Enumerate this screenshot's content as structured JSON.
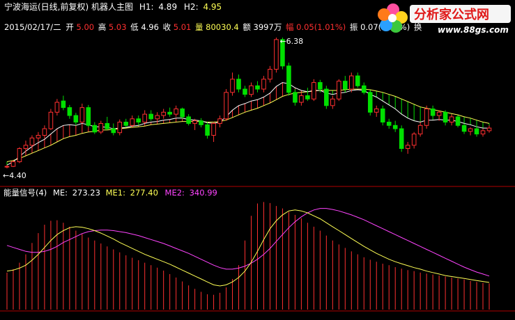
{
  "header": {
    "stock_title": "宁波海运(日线,前复权) 机器人主图",
    "h1_label": "H1:",
    "h1_value": "4.89",
    "h2_label": "H2:",
    "h2_value": "4.95"
  },
  "info_bar": {
    "date": "2015/02/17/二",
    "open_label": "开",
    "open": "5.00",
    "high_label": "高",
    "high": "5.03",
    "low_label": "低",
    "low": "4.96",
    "close_label": "收",
    "close": "5.01",
    "volume_label": "量",
    "volume": "80030.4",
    "amount_label": "额",
    "amount": "3997万",
    "change_label": "幅",
    "change": "0.05(1.01%)",
    "amplitude_label": "振",
    "amplitude": "0.07(1.41%)",
    "turnover_label": "换"
  },
  "price_markers": {
    "max": "6.38",
    "min": "4.40"
  },
  "watermark": {
    "text": "分析家公式网",
    "url": "www.88gs.com"
  },
  "indicator": {
    "title": "能量信号(4)",
    "me_label": "ME:",
    "me_value": "273.23",
    "me1_label": "ME1:",
    "me1_value": "277.40",
    "me2_label": "ME2:",
    "me2_value": "340.99"
  },
  "colors": {
    "up": "#ff3030",
    "down": "#00e000",
    "yellow": "#ffff55",
    "magenta": "#ff44ff",
    "white": "#ffffff",
    "grid": "#b00000"
  },
  "chart_data": [
    {
      "type": "candlestick",
      "title": "宁波海运(日线,前复权) 机器人主图",
      "series": [
        {
          "name": "candles",
          "ohlc": [
            [
              4.42,
              4.45,
              4.4,
              4.43
            ],
            [
              4.43,
              4.52,
              4.42,
              4.5
            ],
            [
              4.5,
              4.72,
              4.48,
              4.7
            ],
            [
              4.7,
              4.82,
              4.62,
              4.75
            ],
            [
              4.75,
              4.9,
              4.7,
              4.86
            ],
            [
              4.86,
              4.95,
              4.8,
              4.9
            ],
            [
              4.9,
              5.05,
              4.85,
              5.0
            ],
            [
              5.0,
              5.3,
              4.98,
              5.25
            ],
            [
              5.25,
              5.45,
              5.2,
              5.4
            ],
            [
              5.42,
              5.5,
              5.28,
              5.32
            ],
            [
              5.32,
              5.36,
              5.15,
              5.2
            ],
            [
              5.2,
              5.24,
              5.05,
              5.1
            ],
            [
              5.1,
              5.38,
              5.08,
              5.32
            ],
            [
              5.32,
              5.36,
              5.02,
              5.05
            ],
            [
              5.05,
              5.1,
              4.92,
              4.95
            ],
            [
              4.95,
              5.12,
              4.92,
              5.08
            ],
            [
              5.08,
              5.18,
              4.98,
              5.0
            ],
            [
              5.0,
              5.08,
              4.9,
              4.94
            ],
            [
              4.94,
              5.14,
              4.9,
              5.1
            ],
            [
              5.1,
              5.15,
              5.02,
              5.05
            ],
            [
              5.05,
              5.2,
              5.02,
              5.15
            ],
            [
              5.15,
              5.2,
              5.05,
              5.1
            ],
            [
              5.1,
              5.28,
              5.08,
              5.22
            ],
            [
              5.22,
              5.28,
              5.12,
              5.15
            ],
            [
              5.15,
              5.25,
              5.1,
              5.2
            ],
            [
              5.2,
              5.3,
              5.15,
              5.25
            ],
            [
              5.25,
              5.32,
              5.18,
              5.22
            ],
            [
              5.22,
              5.35,
              5.18,
              5.3
            ],
            [
              5.3,
              5.32,
              5.15,
              5.18
            ],
            [
              5.18,
              5.22,
              5.05,
              5.08
            ],
            [
              5.08,
              5.15,
              4.98,
              5.12
            ],
            [
              5.12,
              5.16,
              5.02,
              5.06
            ],
            [
              5.06,
              5.1,
              4.85,
              4.9
            ],
            [
              4.9,
              5.1,
              4.8,
              5.08
            ],
            [
              5.08,
              5.2,
              5.02,
              5.15
            ],
            [
              5.15,
              5.6,
              5.12,
              5.55
            ],
            [
              5.55,
              5.85,
              5.5,
              5.75
            ],
            [
              5.75,
              5.82,
              5.55,
              5.6
            ],
            [
              5.6,
              5.65,
              5.48,
              5.52
            ],
            [
              5.52,
              5.7,
              5.48,
              5.65
            ],
            [
              5.65,
              5.72,
              5.55,
              5.6
            ],
            [
              5.6,
              5.8,
              5.55,
              5.75
            ],
            [
              5.75,
              5.95,
              5.7,
              5.9
            ],
            [
              5.9,
              6.38,
              5.85,
              6.35
            ],
            [
              6.35,
              6.38,
              5.9,
              5.95
            ],
            [
              5.95,
              6.0,
              5.5,
              5.55
            ],
            [
              5.55,
              5.6,
              5.35,
              5.4
            ],
            [
              5.4,
              5.55,
              5.35,
              5.5
            ],
            [
              5.5,
              5.62,
              5.42,
              5.45
            ],
            [
              5.45,
              5.75,
              5.42,
              5.7
            ],
            [
              5.7,
              5.74,
              5.55,
              5.6
            ],
            [
              5.6,
              5.65,
              5.3,
              5.35
            ],
            [
              5.35,
              5.5,
              5.3,
              5.45
            ],
            [
              5.45,
              5.75,
              5.42,
              5.72
            ],
            [
              5.72,
              5.8,
              5.55,
              5.6
            ],
            [
              5.6,
              5.85,
              5.55,
              5.8
            ],
            [
              5.8,
              5.85,
              5.62,
              5.65
            ],
            [
              5.65,
              5.7,
              5.52,
              5.55
            ],
            [
              5.55,
              5.58,
              5.2,
              5.25
            ],
            [
              5.25,
              5.35,
              5.18,
              5.3
            ],
            [
              5.3,
              5.35,
              5.05,
              5.1
            ],
            [
              5.1,
              5.15,
              5.0,
              5.05
            ],
            [
              5.05,
              5.12,
              4.95,
              5.0
            ],
            [
              5.0,
              5.05,
              4.65,
              4.7
            ],
            [
              4.7,
              4.8,
              4.62,
              4.75
            ],
            [
              4.75,
              4.95,
              4.7,
              4.92
            ],
            [
              4.92,
              5.1,
              4.88,
              5.05
            ],
            [
              5.05,
              5.35,
              5.0,
              5.3
            ],
            [
              5.3,
              5.35,
              5.18,
              5.2
            ],
            [
              5.2,
              5.28,
              5.12,
              5.25
            ],
            [
              5.25,
              5.28,
              5.05,
              5.1
            ],
            [
              5.1,
              5.22,
              5.05,
              5.18
            ],
            [
              5.18,
              5.2,
              5.02,
              5.05
            ],
            [
              5.05,
              5.08,
              4.92,
              4.96
            ],
            [
              4.96,
              5.02,
              4.9,
              5.0
            ],
            [
              5.0,
              5.05,
              4.88,
              4.92
            ],
            [
              4.92,
              5.0,
              4.88,
              4.97
            ],
            [
              4.97,
              5.05,
              4.94,
              5.01
            ]
          ]
        },
        {
          "name": "H1",
          "values": [
            4.45,
            4.5,
            4.58,
            4.66,
            4.73,
            4.79,
            4.84,
            4.92,
            5.0,
            5.05,
            5.06,
            5.05,
            5.08,
            5.06,
            5.03,
            5.03,
            5.02,
            5.0,
            5.01,
            5.02,
            5.04,
            5.05,
            5.08,
            5.1,
            5.11,
            5.13,
            5.14,
            5.16,
            5.16,
            5.14,
            5.13,
            5.12,
            5.09,
            5.08,
            5.1,
            5.18,
            5.28,
            5.35,
            5.38,
            5.42,
            5.44,
            5.48,
            5.54,
            5.64,
            5.7,
            5.68,
            5.62,
            5.58,
            5.56,
            5.58,
            5.58,
            5.54,
            5.52,
            5.54,
            5.55,
            5.58,
            5.59,
            5.58,
            5.52,
            5.48,
            5.42,
            5.36,
            5.3,
            5.22,
            5.16,
            5.12,
            5.1,
            5.13,
            5.13,
            5.14,
            5.13,
            5.13,
            5.11,
            5.08,
            5.06,
            5.03,
            5.01,
            5.01
          ]
        },
        {
          "name": "H2",
          "values": [
            4.5,
            4.52,
            4.55,
            4.59,
            4.63,
            4.67,
            4.71,
            4.75,
            4.8,
            4.85,
            4.88,
            4.9,
            4.93,
            4.95,
            4.96,
            4.98,
            4.98,
            4.99,
            5.0,
            5.01,
            5.02,
            5.03,
            5.04,
            5.06,
            5.07,
            5.08,
            5.09,
            5.1,
            5.11,
            5.11,
            5.11,
            5.11,
            5.1,
            5.1,
            5.11,
            5.13,
            5.17,
            5.21,
            5.25,
            5.28,
            5.31,
            5.35,
            5.39,
            5.44,
            5.49,
            5.52,
            5.54,
            5.55,
            5.56,
            5.57,
            5.58,
            5.58,
            5.58,
            5.58,
            5.59,
            5.6,
            5.6,
            5.6,
            5.59,
            5.57,
            5.55,
            5.52,
            5.49,
            5.45,
            5.41,
            5.37,
            5.33,
            5.31,
            5.29,
            5.27,
            5.25,
            5.23,
            5.21,
            5.18,
            5.16,
            5.13,
            5.1,
            5.08
          ]
        }
      ]
    },
    {
      "type": "line",
      "title": "能量信号(4)",
      "series": [
        {
          "name": "ME",
          "values": [
            225,
            232,
            245,
            262,
            285,
            305,
            322,
            330,
            331,
            326,
            318,
            310,
            303,
            296,
            290,
            284,
            278,
            272,
            266,
            260,
            255,
            250,
            245,
            240,
            235,
            229,
            222,
            215,
            207,
            199,
            192,
            186,
            181,
            180,
            184,
            195,
            212,
            240,
            290,
            340,
            365,
            368,
            366,
            360,
            355,
            348,
            342,
            335,
            326,
            318,
            310,
            300,
            290,
            282,
            275,
            268,
            262,
            256,
            251,
            247,
            243,
            240,
            236,
            233,
            230,
            228,
            225,
            223,
            221,
            219,
            217,
            215,
            213,
            211,
            208,
            206,
            204,
            203
          ]
        },
        {
          "name": "ME1",
          "values": [
            228,
            230,
            234,
            240,
            250,
            262,
            276,
            290,
            302,
            310,
            316,
            318,
            317,
            314,
            310,
            305,
            299,
            293,
            286,
            280,
            274,
            268,
            262,
            257,
            252,
            247,
            242,
            236,
            230,
            224,
            218,
            212,
            206,
            200,
            198,
            200,
            206,
            215,
            228,
            246,
            268,
            292,
            314,
            330,
            342,
            350,
            352,
            350,
            346,
            340,
            334,
            326,
            318,
            310,
            302,
            294,
            286,
            278,
            271,
            264,
            258,
            252,
            247,
            243,
            239,
            235,
            232,
            228,
            225,
            222,
            219,
            217,
            215,
            213,
            211,
            209,
            207,
            205
          ]
        },
        {
          "name": "ME2",
          "values": [
            280,
            276,
            272,
            268,
            266,
            266,
            268,
            272,
            278,
            286,
            292,
            298,
            304,
            308,
            310,
            311,
            311,
            310,
            308,
            306,
            303,
            300,
            296,
            292,
            288,
            284,
            279,
            274,
            269,
            264,
            258,
            252,
            246,
            240,
            235,
            232,
            232,
            234,
            238,
            244,
            252,
            262,
            274,
            288,
            302,
            316,
            328,
            338,
            346,
            352,
            355,
            355,
            353,
            350,
            346,
            342,
            337,
            332,
            326,
            320,
            314,
            308,
            302,
            296,
            290,
            284,
            278,
            272,
            266,
            260,
            254,
            248,
            242,
            236,
            231,
            226,
            222,
            218
          ]
        }
      ]
    }
  ]
}
